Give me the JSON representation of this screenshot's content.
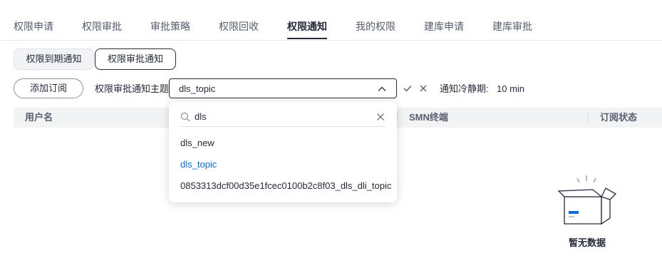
{
  "tabs": [
    {
      "label": "权限申请"
    },
    {
      "label": "权限审批"
    },
    {
      "label": "审批策略"
    },
    {
      "label": "权限回收"
    },
    {
      "label": "权限通知",
      "active": true
    },
    {
      "label": "我的权限"
    },
    {
      "label": "建库申请"
    },
    {
      "label": "建库审批"
    }
  ],
  "subtabs": [
    {
      "label": "权限到期通知"
    },
    {
      "label": "权限审批通知",
      "active": true
    }
  ],
  "toolbar": {
    "add_subscription_label": "添加订阅",
    "topic_label": "权限审批通知主题",
    "topic_value": "dls_topic",
    "cooldown_label": "通知冷静期:",
    "cooldown_value": "10 min"
  },
  "table": {
    "columns": [
      "用户名",
      "SMN终端",
      "订阅状态"
    ]
  },
  "dropdown": {
    "search_value": "dls",
    "options": [
      {
        "label": "dls_new"
      },
      {
        "label": "dls_topic",
        "selected": true
      },
      {
        "label": "0853313dcf00d35e1fcec0100b2c8f03_dls_dli_topic"
      }
    ]
  },
  "empty_state": {
    "label": "暂无数据"
  },
  "colors": {
    "accent": "#0c6fd8",
    "text": "#252b3a",
    "header_bg": "#f2f3f5"
  }
}
